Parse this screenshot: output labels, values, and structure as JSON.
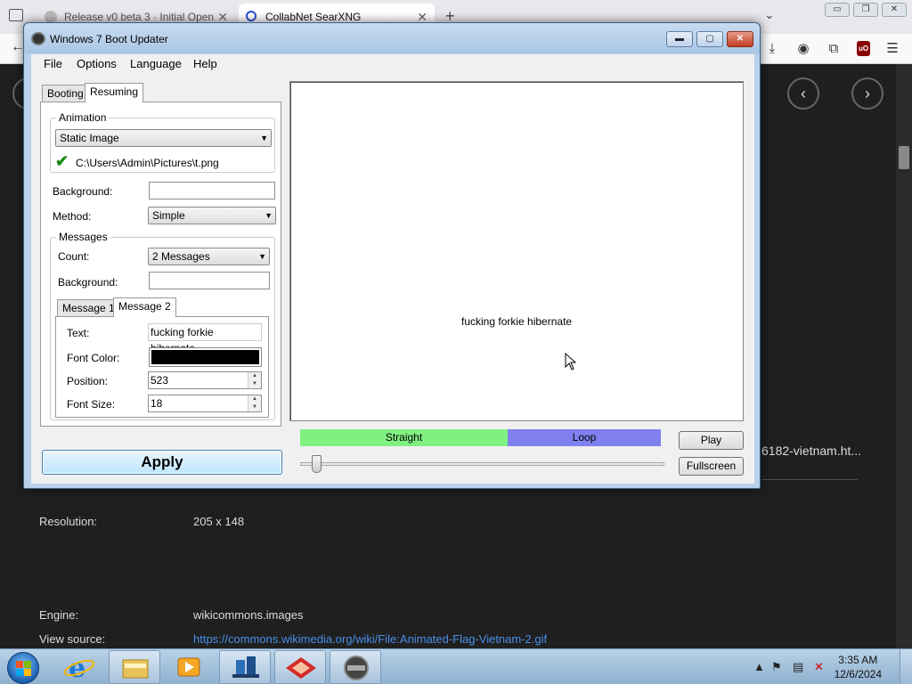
{
  "browser": {
    "tabs": [
      {
        "label": "Release v0 beta 3 · Initial Open",
        "close": "✕"
      },
      {
        "label": "CollabNet SearXNG",
        "close": "✕"
      }
    ],
    "new_tab": "+",
    "window_controls": [
      "▭",
      "❐",
      "✕"
    ]
  },
  "page": {
    "filename": "6182-vietnam.ht...",
    "resolution_label": "Resolution:",
    "resolution_value": "205 x 148",
    "engine_label": "Engine:",
    "engine_value": "wikicommons.images",
    "view_source_label": "View source:",
    "view_source_value": "https://commons.wikimedia.org/wiki/File:Animated-Flag-Vietnam-2.gif"
  },
  "app": {
    "title": "Windows 7 Boot Updater",
    "controls": {
      "minimize": "▬",
      "maximize": "▢",
      "close": "✕"
    },
    "menu": [
      "File",
      "Options",
      "Language",
      "Help"
    ],
    "tabs": [
      "Booting",
      "Resuming"
    ],
    "animation": {
      "group_title": "Animation",
      "type_value": "Static Image",
      "path": "C:\\Users\\Admin\\Pictures\\t.png",
      "check": "✔"
    },
    "background_label": "Background:",
    "background_value": "",
    "method_label": "Method:",
    "method_value": "Simple",
    "messages": {
      "group_title": "Messages",
      "count_label": "Count:",
      "count_value": "2 Messages",
      "background_label": "Background:",
      "background_value": "",
      "tabs": [
        "Message 1",
        "Message 2"
      ],
      "text_label": "Text:",
      "text_value": "fucking forkie hibernate",
      "font_color_label": "Font Color:",
      "font_color": "#000000",
      "position_label": "Position:",
      "position_value": "523",
      "font_size_label": "Font Size:",
      "font_size_value": "18"
    },
    "preview_text": "fucking forkie hibernate",
    "straight_label": "Straight",
    "loop_label": "Loop",
    "play_label": "Play",
    "fullscreen_label": "Fullscreen",
    "apply_label": "Apply"
  },
  "taskbar": {
    "time": "3:35 AM",
    "date": "12/6/2024",
    "tray_arrow": "▲"
  },
  "colors": {
    "straight_bar": "#80f080",
    "loop_bar": "#8080f0",
    "page_bg": "#1f1f1f",
    "link": "#4a8fe8"
  }
}
